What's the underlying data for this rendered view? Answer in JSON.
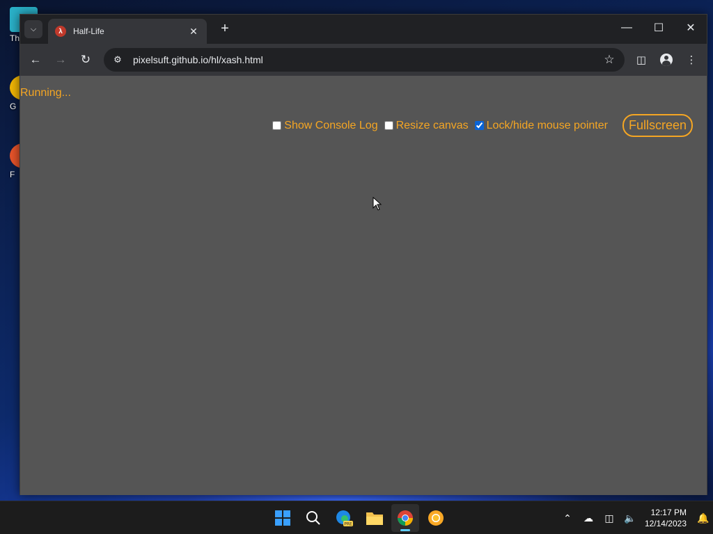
{
  "desktop": {
    "icons": [
      {
        "label": "Th"
      },
      {
        "label": "G"
      },
      {
        "label": "F"
      }
    ]
  },
  "browser": {
    "tab": {
      "title": "Half-Life"
    },
    "url": "pixelsuft.github.io/hl/xash.html"
  },
  "page": {
    "status": "Running...",
    "options": [
      {
        "label": "Show Console Log",
        "checked": false
      },
      {
        "label": "Resize canvas",
        "checked": false
      },
      {
        "label": "Lock/hide mouse pointer",
        "checked": true
      }
    ],
    "fullscreen_label": "Fullscreen"
  },
  "taskbar": {
    "clock_time": "12:17 PM",
    "clock_date": "12/14/2023",
    "edge_badge": "PRE"
  },
  "colors": {
    "page_bg": "#555555",
    "accent": "#f5a623",
    "chrome_dark": "#202124",
    "chrome_toolbar": "#35363a"
  }
}
